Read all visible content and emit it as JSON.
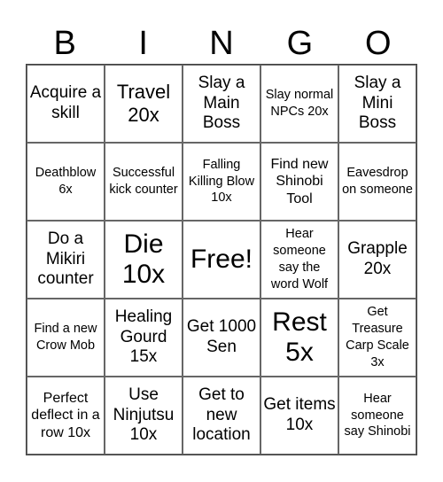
{
  "header": {
    "letters": [
      "B",
      "I",
      "N",
      "G",
      "O"
    ]
  },
  "cells": [
    "Acquire a skill",
    "Travel 20x",
    "Slay a Main Boss",
    "Slay normal NPCs 20x",
    "Slay a Mini Boss",
    "Deathblow 6x",
    "Successful kick counter",
    "Falling Killing Blow 10x",
    "Find new Shinobi Tool",
    "Eavesdrop on someone",
    "Do a Mikiri counter",
    "Die 10x",
    "Free!",
    "Hear someone say the word Wolf",
    "Grapple 20x",
    "Find a new Crow Mob",
    "Healing Gourd 15x",
    "Get 1000 Sen",
    "Rest 5x",
    "Get Treasure Carp Scale 3x",
    "Perfect deflect in a row 10x",
    "Use Ninjutsu 10x",
    "Get to new location",
    "Get items 10x",
    "Hear someone say Shinobi"
  ]
}
